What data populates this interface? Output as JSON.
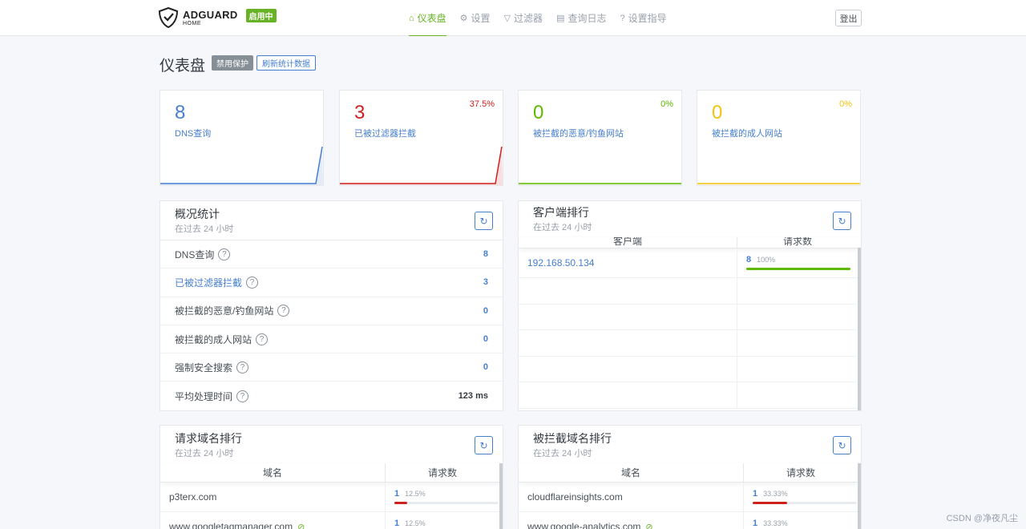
{
  "header": {
    "logo_main": "ADGUARD",
    "logo_sub": "HOME",
    "status": "启用中",
    "nav": [
      {
        "label": "仪表盘",
        "icon": "⌂",
        "active": true
      },
      {
        "label": "设置",
        "icon": "⚙",
        "active": false
      },
      {
        "label": "过滤器",
        "icon": "▽",
        "active": false
      },
      {
        "label": "查询日志",
        "icon": "▤",
        "active": false
      },
      {
        "label": "设置指导",
        "icon": "?",
        "active": false
      }
    ],
    "logout": "登出"
  },
  "page": {
    "title": "仪表盘",
    "disable_protection": "禁用保护",
    "refresh_stats": "刷新统计数据"
  },
  "cards": [
    {
      "value": "8",
      "label": "DNS查询",
      "pct": "",
      "color": "#467fcf"
    },
    {
      "value": "3",
      "label": "已被过滤器拦截",
      "pct": "37.5%",
      "color": "#cd201f"
    },
    {
      "value": "0",
      "label": "被拦截的恶意/钓鱼网站",
      "pct": "0%",
      "color": "#5eba00"
    },
    {
      "value": "0",
      "label": "被拦截的成人网站",
      "pct": "0%",
      "color": "#f1c40f"
    }
  ],
  "overview": {
    "title": "概况统计",
    "subtitle": "在过去 24 小时",
    "rows": [
      {
        "label": "DNS查询",
        "value": "8",
        "label_link": false
      },
      {
        "label": "已被过滤器拦截",
        "value": "3",
        "label_link": true
      },
      {
        "label": "被拦截的恶意/钓鱼网站",
        "value": "0",
        "label_link": false
      },
      {
        "label": "被拦截的成人网站",
        "value": "0",
        "label_link": false
      },
      {
        "label": "强制安全搜索",
        "value": "0",
        "label_link": false
      },
      {
        "label": "平均处理时间",
        "value": "123 ms",
        "label_link": false
      }
    ]
  },
  "clients": {
    "title": "客户端排行",
    "subtitle": "在过去 24 小时",
    "col_client": "客户端",
    "col_requests": "请求数",
    "rows": [
      {
        "client": "192.168.50.134",
        "count": "8",
        "pct": "100%",
        "fill": 1.0
      }
    ]
  },
  "top_domains": {
    "title": "请求域名排行",
    "subtitle": "在过去 24 小时",
    "col_domain": "域名",
    "col_requests": "请求数",
    "rows": [
      {
        "domain": "p3terx.com",
        "count": "1",
        "pct": "12.5%",
        "fill": 0.125,
        "eye": false
      },
      {
        "domain": "www.googletagmanager.com",
        "count": "1",
        "pct": "12.5%",
        "fill": 0.125,
        "eye": true
      }
    ]
  },
  "blocked_domains": {
    "title": "被拦截域名排行",
    "subtitle": "在过去 24 小时",
    "col_domain": "域名",
    "col_requests": "请求数",
    "rows": [
      {
        "domain": "cloudflareinsights.com",
        "count": "1",
        "pct": "33.33%",
        "fill": 0.3333,
        "eye": false
      },
      {
        "domain": "www.google-analytics.com",
        "count": "1",
        "pct": "33.33%",
        "fill": 0.3333,
        "eye": true
      }
    ]
  },
  "watermark": "CSDN @净夜凡尘"
}
